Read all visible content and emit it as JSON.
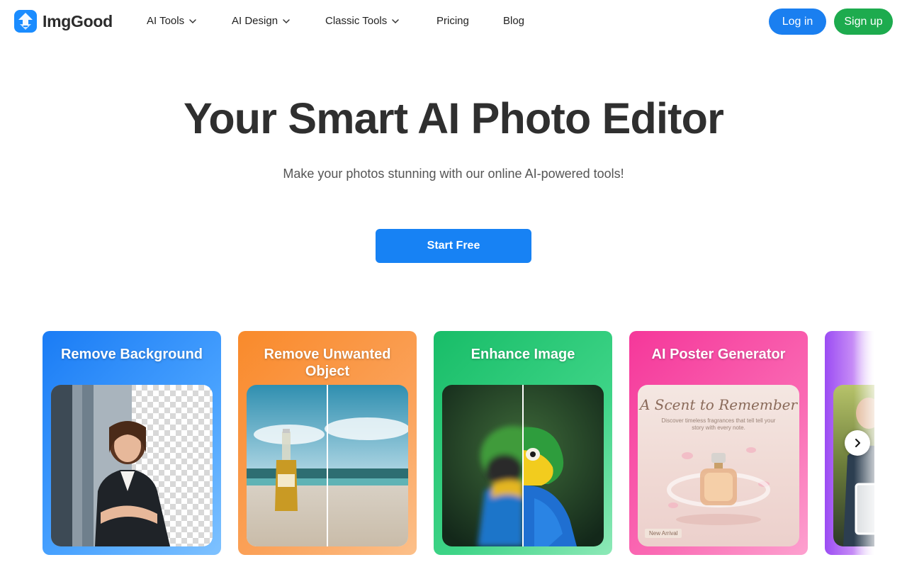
{
  "brand": {
    "name": "ImgGood"
  },
  "nav": {
    "items": [
      {
        "label": "AI Tools",
        "has_dropdown": true
      },
      {
        "label": "AI Design",
        "has_dropdown": true
      },
      {
        "label": "Classic Tools",
        "has_dropdown": true
      },
      {
        "label": "Pricing",
        "has_dropdown": false
      },
      {
        "label": "Blog",
        "has_dropdown": false
      }
    ]
  },
  "auth": {
    "login_label": "Log in",
    "signup_label": "Sign up"
  },
  "hero": {
    "title": "Your Smart AI Photo Editor",
    "subtitle": "Make your photos stunning with our online AI-powered tools!",
    "cta_label": "Start Free"
  },
  "cards": [
    {
      "title": "Remove Background"
    },
    {
      "title": "Remove Unwanted Object"
    },
    {
      "title": "Enhance Image"
    },
    {
      "title": "AI Poster Generator",
      "poster": {
        "heading": "A Scent to Remember",
        "body": "Discover timeless fragrances that tell tell your story with every note.",
        "tag": "New Arrival"
      }
    },
    {
      "title": ""
    }
  ],
  "icons": {
    "logo": "imggood-logo-icon",
    "dropdown": "chevron-down-icon",
    "carousel_next": "chevron-right-icon"
  },
  "colors": {
    "primary": "#1a7ff0",
    "signup": "#1dab4e",
    "card_remove_bg": "#1a7cf5",
    "card_remove_object": "#f98a2b",
    "card_enhance": "#18bd68",
    "card_poster": "#f5379a",
    "card_next": "#9b4cf3"
  }
}
